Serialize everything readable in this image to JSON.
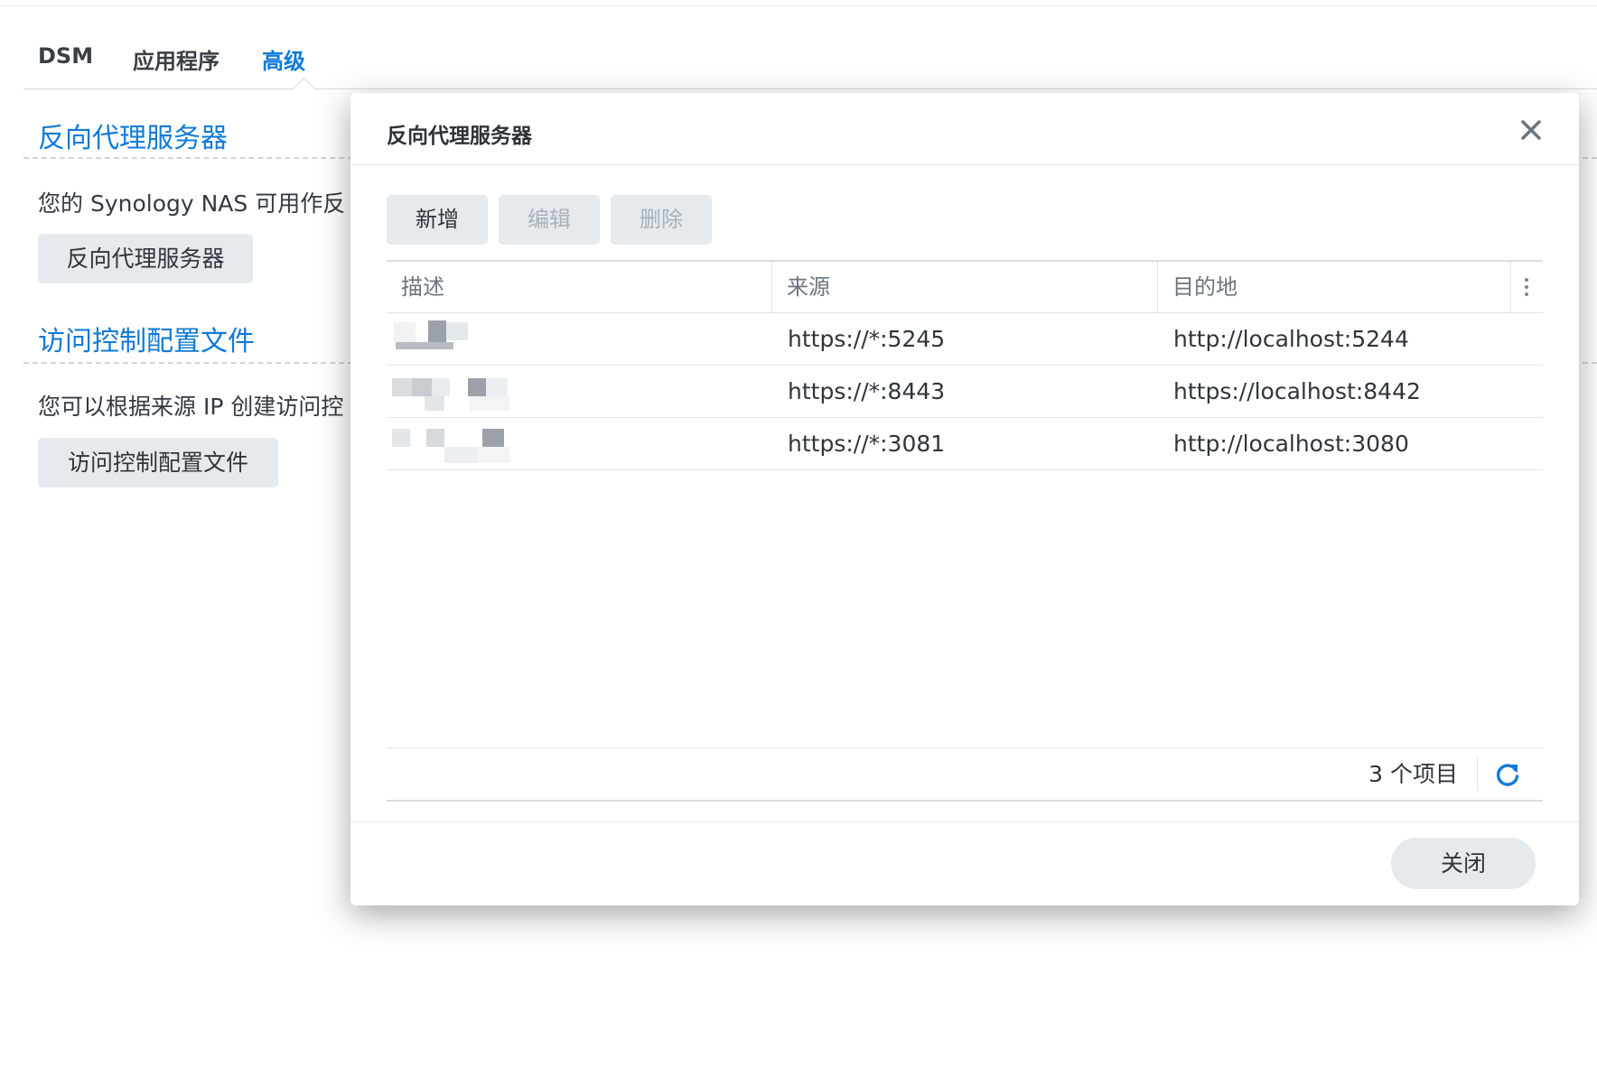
{
  "tabs": [
    {
      "label": "DSM"
    },
    {
      "label": "应用程序"
    },
    {
      "label": "高级"
    }
  ],
  "active_tab": "高级",
  "sections": {
    "reverse_proxy": {
      "title": "反向代理服务器",
      "description": "您的 Synology NAS 可用作反",
      "button": "反向代理服务器"
    },
    "access_control": {
      "title": "访问控制配置文件",
      "description": "您可以根据来源 IP 创建访问控",
      "button": "访问控制配置文件"
    }
  },
  "dialog": {
    "title": "反向代理服务器",
    "toolbar": {
      "add": "新增",
      "edit": "编辑",
      "delete": "删除"
    },
    "columns": [
      "描述",
      "来源",
      "目的地"
    ],
    "rows": [
      {
        "description": "",
        "source": "https://*:5245",
        "destination": "http://localhost:5244"
      },
      {
        "description": "",
        "source": "https://*:8443",
        "destination": "https://localhost:8442"
      },
      {
        "description": "",
        "source": "https://*:3081",
        "destination": "http://localhost:3080"
      }
    ],
    "item_count": "3 个项目",
    "close_label": "关闭"
  },
  "colors": {
    "accent": "#0f7ad8",
    "button_bg": "#e5eaee",
    "disabled_text": "#a9b1b8"
  },
  "icons": [
    "close-icon",
    "column-menu-icon",
    "refresh-icon"
  ]
}
